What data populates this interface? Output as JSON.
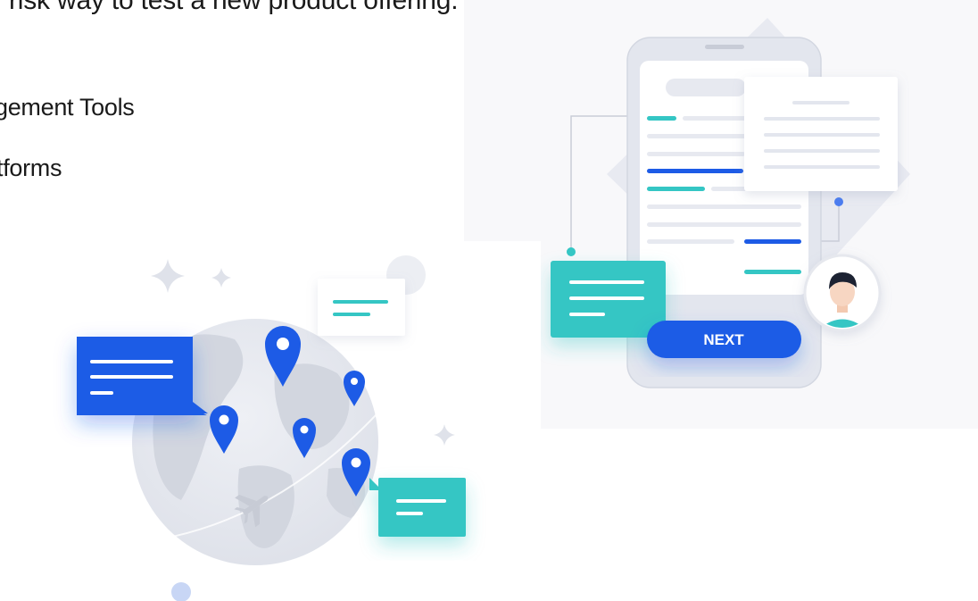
{
  "tagline": "risk way to test a new product offering.",
  "list_items": [
    "gement Tools",
    "tforms"
  ],
  "phone_card": {
    "button_label": "NEXT"
  },
  "colors": {
    "primary_blue": "#1d5be6",
    "teal": "#34c6c4",
    "globe_gray": "#e5e7ee",
    "phone_frame": "#e3e6ee",
    "panel_bg": "#f8f8fa"
  },
  "icons": [
    "sparkle-icon",
    "location-pin-icon",
    "airplane-icon",
    "chat-bubble-icon",
    "user-avatar-icon"
  ]
}
